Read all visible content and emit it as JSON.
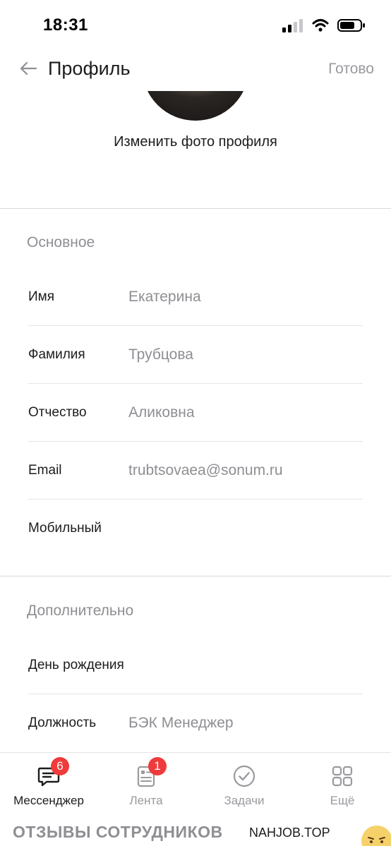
{
  "status_bar": {
    "time": "18:31",
    "icons": [
      "cellular-signal-icon",
      "wifi-icon",
      "battery-icon"
    ]
  },
  "header": {
    "title": "Профиль",
    "done_label": "Готово",
    "back_icon": "arrow-left-icon"
  },
  "profile": {
    "change_photo_label": "Изменить фото профиля"
  },
  "sections": {
    "basic": {
      "title": "Основное",
      "fields": [
        {
          "label": "Имя",
          "value": "Екатерина"
        },
        {
          "label": "Фамилия",
          "value": "Трубцова"
        },
        {
          "label": "Отчество",
          "value": "Аликовна"
        },
        {
          "label": "Email",
          "value": "trubtsovaea@sonum.ru"
        },
        {
          "label": "Мобильный",
          "value": ""
        }
      ]
    },
    "additional": {
      "title": "Дополнительно",
      "fields": [
        {
          "label": "День рождения",
          "value": ""
        },
        {
          "label": "Должность",
          "value": "БЭК Менеджер"
        }
      ]
    }
  },
  "tab_bar": {
    "tabs": [
      {
        "label": "Мессенджер",
        "icon": "chat-icon",
        "badge": "6",
        "active": true
      },
      {
        "label": "Лента",
        "icon": "feed-icon",
        "badge": "1",
        "active": false
      },
      {
        "label": "Задачи",
        "icon": "check-circle-icon",
        "badge": "",
        "active": false
      },
      {
        "label": "Ещё",
        "icon": "grid-icon",
        "badge": "",
        "active": false
      }
    ]
  },
  "watermark": {
    "left_text": "ОТЗЫВЫ СОТРУДНИКОВ",
    "right_text": "NAHJOB.TOP"
  },
  "colors": {
    "badge": "#ef3b3b",
    "muted": "#8e8e93",
    "text": "#1c1c1e"
  }
}
